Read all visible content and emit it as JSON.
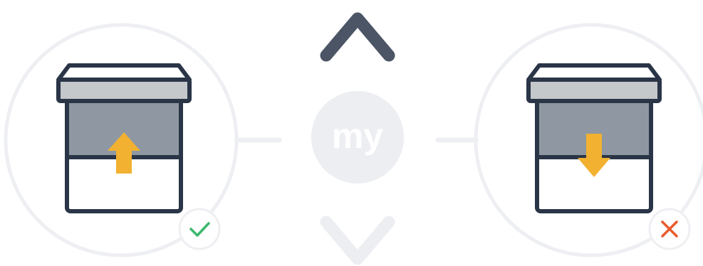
{
  "center": {
    "button_label": "my",
    "up_icon": "chevron-up-icon",
    "down_icon": "chevron-down-icon"
  },
  "left_panel": {
    "action": "raise",
    "arrow_icon": "arrow-up-icon",
    "status_icon": "check-icon",
    "status": "correct"
  },
  "right_panel": {
    "action": "lower",
    "arrow_icon": "arrow-down-icon",
    "status_icon": "cross-icon",
    "status": "incorrect"
  },
  "colors": {
    "outline": "#2a3547",
    "blind": "#8f98a2",
    "cassette": "#c5c8cb",
    "arrow": "#f2b131",
    "ring": "#eeeff2",
    "chevron_up": "#4b5565",
    "chevron_down": "#eceef1",
    "check": "#3bb96e",
    "cross": "#e85b2d",
    "my_button": "#eceef1"
  }
}
